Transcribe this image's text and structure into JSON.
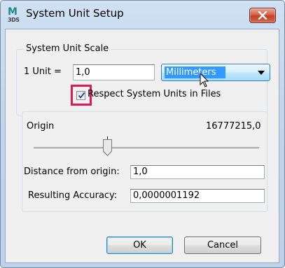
{
  "window": {
    "title": "System Unit Setup",
    "app_icon": {
      "letter": "M",
      "sub": "3DS"
    }
  },
  "unit_scale": {
    "group_title": "System Unit Scale",
    "unit_label": "1 Unit =",
    "unit_value": "1,0",
    "unit_type": "Millimeters",
    "respect_checkbox_label": "Respect System Units in Files",
    "respect_checked": true
  },
  "origin": {
    "label": "Origin",
    "value": "16777215,0",
    "slider_position": 0.4
  },
  "distance": {
    "label": "Distance from origin:",
    "value": "1,0"
  },
  "accuracy": {
    "label": "Resulting Accuracy:",
    "value": "0,0000001192"
  },
  "buttons": {
    "ok": "OK",
    "cancel": "Cancel"
  },
  "colors": {
    "highlight": "#e0195a",
    "selection": "#3399ff",
    "close_button": "#c23f25"
  }
}
